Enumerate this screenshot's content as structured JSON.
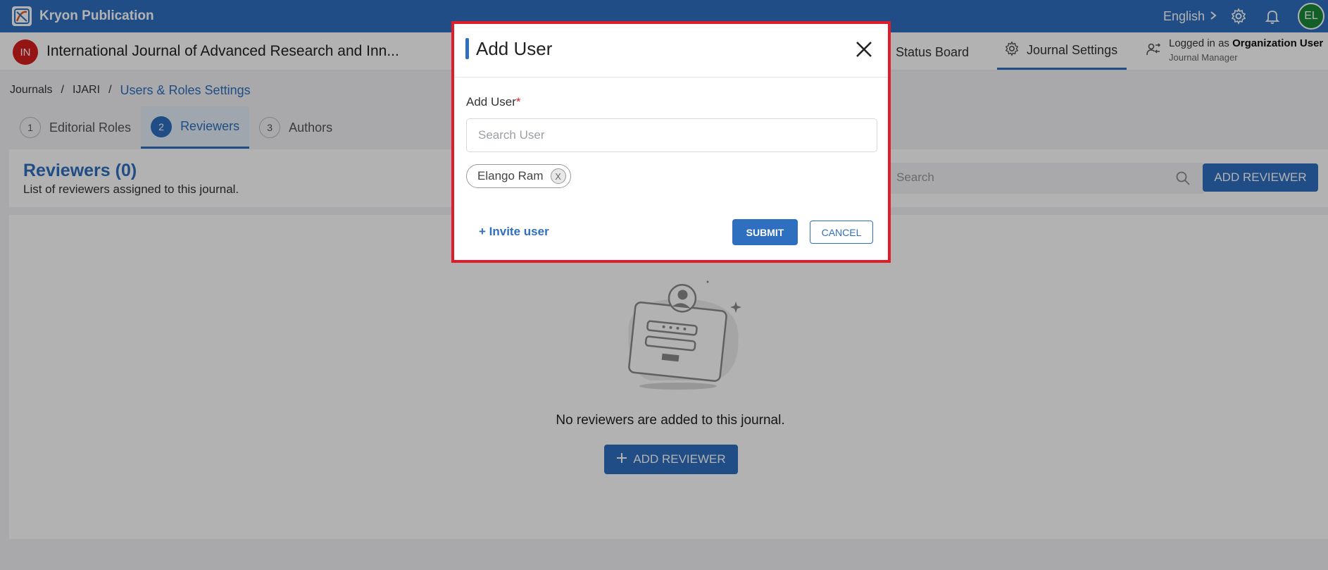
{
  "app": {
    "title": "Kryon Publication",
    "language": "English",
    "avatar_initials": "EL"
  },
  "journal": {
    "badge": "IN",
    "title": "International Journal of Advanced Research and Inn...",
    "nav": {
      "status_board": "Status Board",
      "journal_settings": "Journal Settings"
    },
    "logged_in": {
      "prefix": "Logged in as",
      "org": "Organization User",
      "role": "Journal Manager"
    }
  },
  "breadcrumb": {
    "journals": "Journals",
    "sep": "/",
    "journal_code": "IJARI",
    "current": "Users & Roles Settings"
  },
  "tabs": [
    {
      "num": "1",
      "label": "Editorial Roles"
    },
    {
      "num": "2",
      "label": "Reviewers"
    },
    {
      "num": "3",
      "label": "Authors"
    }
  ],
  "section": {
    "title": "Reviewers (0)",
    "subtitle": "List of reviewers assigned to this journal.",
    "search_placeholder": "Search",
    "add_button": "ADD REVIEWER"
  },
  "empty_state": {
    "message": "No reviewers are added to this journal.",
    "button": "ADD REVIEWER"
  },
  "modal": {
    "title": "Add User",
    "field_label": "Add User",
    "required_mark": "*",
    "search_placeholder": "Search User",
    "selected_user": "Elango Ram",
    "chip_remove": "X",
    "invite_link": "+ Invite user",
    "submit": "SUBMIT",
    "cancel": "CANCEL"
  },
  "colors": {
    "primary": "#2f6fbf",
    "highlight_border": "#e21b2b",
    "journal_badge": "#d61f1f",
    "avatar": "#1b8a3a"
  }
}
